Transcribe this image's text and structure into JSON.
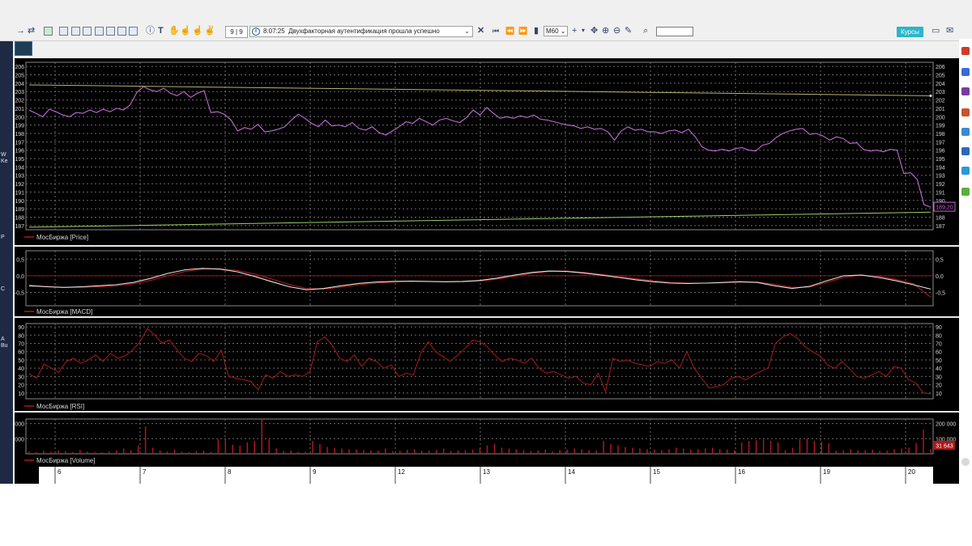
{
  "toolbar": {
    "position": "9 | 9",
    "status_time": "8:07:25",
    "status_message": "Двухфакторная аутентификация прошла успешно",
    "timeframe": "M60",
    "course_button": "Курсы",
    "search_value": ""
  },
  "left_strip_texts": [
    "QI",
    "W",
    "Ke",
    "P",
    "C",
    "A",
    "Bu"
  ],
  "colors": {
    "price_line": "#c06bd4",
    "band_upper": "#b8b370",
    "band_lower": "#9bd06a",
    "macd_line": "#e0e0e0",
    "macd_signal": "#b01818",
    "rsi_line": "#a81a1a",
    "volume_bar": "#b01818",
    "legend_line": "#b01818",
    "background": "#000000",
    "grid": "#6a6a6a",
    "axis_text": "#d8d8d8",
    "course_button": "#28b6c9"
  },
  "chart_data": [
    {
      "type": "line",
      "legend": "МосБиржа [Price]",
      "y_ticks": [
        "206",
        "205",
        "204",
        "203",
        "202",
        "201",
        "200",
        "199",
        "198",
        "197",
        "196",
        "195",
        "194",
        "193",
        "192",
        "191",
        "190",
        "189",
        "188",
        "187"
      ],
      "ylim": [
        186.5,
        206.5
      ],
      "last_value_label": "189,20",
      "x_ticks": [
        "6",
        "7",
        "8",
        "9",
        "12",
        "13",
        "14",
        "15",
        "16",
        "19",
        "20"
      ],
      "series": [
        {
          "values": [
            200.8,
            200.4,
            200.0,
            200.9,
            200.6,
            200.2,
            200.0,
            200.5,
            200.4,
            200.8,
            200.5,
            200.9,
            200.6,
            201.0,
            200.8,
            201.4,
            202.9,
            203.6,
            203.2,
            203.0,
            203.4,
            202.8,
            202.5,
            203.0,
            202.3,
            202.8,
            203.1,
            200.5,
            200.6,
            200.3,
            199.6,
            198.3,
            198.7,
            198.5,
            199.1,
            198.2,
            198.3,
            198.5,
            198.8,
            199.6,
            200.3,
            199.8,
            199.2,
            198.8,
            199.6,
            198.9,
            199.0,
            198.8,
            199.3,
            198.6,
            198.4,
            198.8,
            198.1,
            197.8,
            198.3,
            198.8,
            199.4,
            199.2,
            199.8,
            199.4,
            199.0,
            199.6,
            199.8,
            199.5,
            199.3,
            199.9,
            200.8,
            200.2,
            201.1,
            200.4,
            199.8,
            200.0,
            199.8,
            200.1,
            199.9,
            200.2,
            199.7,
            199.6,
            199.4,
            199.2,
            199.0,
            198.9,
            198.6,
            198.8,
            198.5,
            198.6,
            198.2,
            197.2,
            198.3,
            198.8,
            198.4,
            198.5,
            198.2,
            198.2,
            198.0,
            198.3,
            198.4,
            198.1,
            198.5,
            197.6,
            196.4,
            196.0,
            195.9,
            196.1,
            195.9,
            196.2,
            196.3,
            196.0,
            195.9,
            196.6,
            196.8,
            197.5,
            198.0,
            198.3,
            198.5,
            198.6,
            197.9,
            198.0,
            197.7,
            197.2,
            197.6,
            197.4,
            196.8,
            196.9,
            196.1,
            195.9,
            196.0,
            195.8,
            196.1,
            196.0,
            193.2,
            193.3,
            192.5,
            189.5,
            189.2
          ]
        }
      ],
      "bands": {
        "upper_start": 203.8,
        "upper_end": 202.5,
        "lower_start": 186.8,
        "lower_end": 188.6
      }
    },
    {
      "type": "line",
      "legend": "МосБиржа [MACD]",
      "y_ticks": [
        "0,5",
        "0,0",
        "-0,5"
      ],
      "ylim": [
        -0.9,
        0.75
      ],
      "series": [
        {
          "name": "macd",
          "values": [
            -0.3,
            -0.33,
            -0.35,
            -0.33,
            -0.3,
            -0.27,
            -0.2,
            -0.08,
            0.07,
            0.18,
            0.22,
            0.2,
            0.12,
            -0.02,
            -0.18,
            -0.33,
            -0.42,
            -0.38,
            -0.3,
            -0.23,
            -0.19,
            -0.17,
            -0.16,
            -0.17,
            -0.18,
            -0.17,
            -0.14,
            -0.07,
            0.02,
            0.1,
            0.14,
            0.13,
            0.08,
            0.02,
            -0.05,
            -0.12,
            -0.18,
            -0.22,
            -0.23,
            -0.22,
            -0.2,
            -0.18,
            -0.2,
            -0.3,
            -0.38,
            -0.32,
            -0.15,
            0.0,
            0.02,
            -0.05,
            -0.15,
            -0.27,
            -0.4
          ]
        },
        {
          "name": "signal",
          "values": [
            -0.28,
            -0.32,
            -0.35,
            -0.35,
            -0.33,
            -0.3,
            -0.24,
            -0.14,
            0.0,
            0.13,
            0.2,
            0.21,
            0.16,
            0.05,
            -0.1,
            -0.26,
            -0.38,
            -0.4,
            -0.34,
            -0.27,
            -0.22,
            -0.19,
            -0.17,
            -0.17,
            -0.18,
            -0.18,
            -0.16,
            -0.1,
            -0.02,
            0.07,
            0.13,
            0.14,
            0.1,
            0.04,
            -0.02,
            -0.09,
            -0.15,
            -0.2,
            -0.22,
            -0.22,
            -0.21,
            -0.19,
            -0.19,
            -0.26,
            -0.35,
            -0.34,
            -0.2,
            -0.05,
            0.02,
            -0.02,
            -0.11,
            -0.24,
            -0.64
          ]
        }
      ],
      "zero_line": 0
    },
    {
      "type": "line",
      "legend": "МосБиржа [RSI]",
      "y_ticks": [
        "90",
        "80",
        "70",
        "60",
        "50",
        "40",
        "30",
        "20",
        "10"
      ],
      "ylim": [
        3,
        94
      ],
      "series": [
        {
          "values": [
            33,
            28,
            45,
            40,
            35,
            48,
            52,
            46,
            50,
            56,
            48,
            58,
            52,
            55,
            62,
            72,
            88,
            80,
            70,
            74,
            62,
            52,
            48,
            58,
            55,
            48,
            62,
            30,
            28,
            26,
            24,
            14,
            32,
            28,
            36,
            30,
            32,
            30,
            36,
            72,
            78,
            68,
            52,
            48,
            56,
            42,
            52,
            48,
            40,
            44,
            30,
            34,
            32,
            58,
            72,
            60,
            54,
            48,
            56,
            64,
            74,
            72,
            66,
            56,
            48,
            52,
            50,
            46,
            52,
            40,
            34,
            36,
            32,
            28,
            30,
            22,
            20,
            34,
            12,
            52,
            48,
            50,
            46,
            44,
            42,
            48,
            46,
            50,
            40,
            60,
            40,
            28,
            16,
            18,
            20,
            28,
            30,
            26,
            32,
            36,
            40,
            70,
            78,
            82,
            76,
            66,
            60,
            55,
            44,
            40,
            48,
            40,
            30,
            28,
            32,
            36,
            30,
            42,
            40,
            26,
            22,
            10,
            9
          ]
        }
      ]
    },
    {
      "type": "bar",
      "legend": "МосБиржа [Volume]",
      "y_ticks": [
        "200 000",
        "100 000"
      ],
      "ylim": [
        0,
        230000
      ],
      "last_value_label": "31 643",
      "series": [
        {
          "values": [
            15000,
            12000,
            20000,
            14000,
            22000,
            18000,
            12000,
            25000,
            15000,
            12000,
            10000,
            14000,
            22000,
            35000,
            25000,
            55000,
            180000,
            40000,
            22000,
            15000,
            28000,
            14000,
            12000,
            18000,
            22000,
            12000,
            95000,
            85000,
            60000,
            55000,
            75000,
            85000,
            235000,
            95000,
            35000,
            18000,
            22000,
            12000,
            14000,
            85000,
            65000,
            45000,
            40000,
            35000,
            30000,
            28000,
            25000,
            22000,
            20000,
            35000,
            18000,
            20000,
            25000,
            30000,
            20000,
            22000,
            25000,
            35000,
            18000,
            22000,
            25000,
            28000,
            35000,
            55000,
            65000,
            40000,
            35000,
            30000,
            25000,
            18000,
            22000,
            28000,
            15000,
            25000,
            28000,
            35000,
            30000,
            25000,
            22000,
            85000,
            65000,
            55000,
            45000,
            40000,
            35000,
            30000,
            28000,
            25000,
            30000,
            40000,
            35000,
            28000,
            30000,
            35000,
            40000,
            30000,
            28000,
            25000,
            75000,
            85000,
            90000,
            95000,
            85000,
            75000,
            25000,
            40000,
            95000,
            100000,
            85000,
            80000,
            70000,
            20000,
            25000,
            30000,
            22000,
            25000,
            28000,
            18000,
            20000,
            30000,
            35000,
            40000,
            70000,
            160000,
            31643
          ]
        }
      ]
    }
  ]
}
